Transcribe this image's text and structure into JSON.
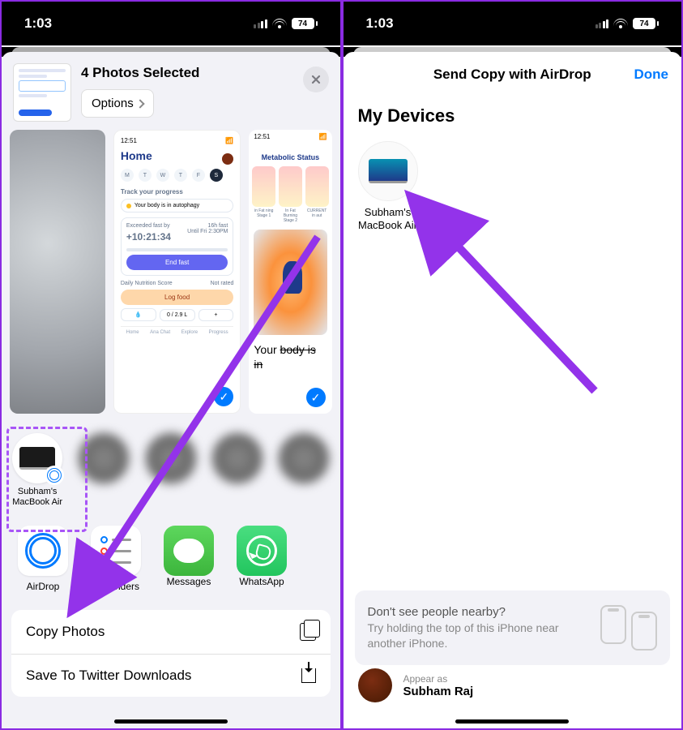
{
  "status": {
    "time": "1:03",
    "battery": "74"
  },
  "left": {
    "header_title": "4 Photos Selected",
    "options": "Options",
    "preview2": {
      "status_time": "12:51",
      "title": "Home",
      "days": [
        "M",
        "T",
        "W",
        "T",
        "F",
        "S"
      ],
      "track": "Track your progress",
      "autophagy": "Your body is in autophagy",
      "exceeded": "Exceeded fast by",
      "timer": "+10:21:34",
      "fast_label": "16h fast",
      "until": "Until Fri 2:30PM",
      "end": "End fast",
      "nutrition": "Daily Nutrition Score",
      "notrated": "Not rated",
      "logfood": "Log food",
      "water": "0 / 2.9 L",
      "tabs": [
        "Home",
        "Ana Chat",
        "Explore",
        "Progress"
      ]
    },
    "preview3": {
      "title": "Metabolic Status",
      "labels": [
        "in Fat\nning Stage 1",
        "In Fat\nBurning Stage 2",
        "CURRENT\nin aut"
      ],
      "body_text": "Your body is in"
    },
    "contact1": "Subham's\nMacBook Air",
    "apps": {
      "airdrop": "AirDrop",
      "reminders": "Reminders",
      "messages": "Messages",
      "whatsapp": "WhatsApp"
    },
    "actions": {
      "copy": "Copy Photos",
      "save": "Save To Twitter Downloads"
    }
  },
  "right": {
    "title": "Send Copy with AirDrop",
    "done": "Done",
    "section": "My Devices",
    "device": "Subham's\nMacBook Air",
    "hint_title": "Don't see people nearby?",
    "hint_sub": "Try holding the top of this iPhone near another iPhone.",
    "appear_label": "Appear as",
    "appear_name": "Subham Raj"
  }
}
